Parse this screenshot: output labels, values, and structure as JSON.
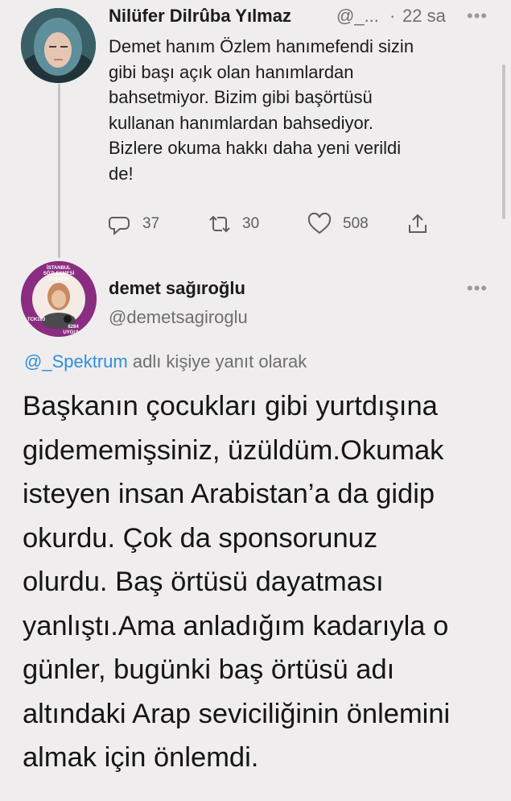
{
  "first_tweet": {
    "author_name": "Nilüfer Dilrûba Yılmaz",
    "handle": "@_...",
    "separator": "·",
    "time": "22 sa",
    "more": "•••",
    "text": [
      "Demet hanım Özlem hanımefendi sizin",
      "gibi başı açık olan hanımlardan",
      "bahsetmiyor. Bizim gibi başörtüsü",
      "kullanan hanımlardan bahsediyor.",
      "Bizlere okuma hakkı daha yeni verildi",
      "de!"
    ],
    "replies": "37",
    "retweets": "30",
    "likes": "508"
  },
  "second_tweet": {
    "author_name": "demet sağıroğlu",
    "handle": "@demetsagiroglu",
    "more": "•••",
    "avatar_ring_text_top": "İSTANBUL SÖZLEŞMESİ YAŞATIR",
    "avatar_ring_text_bottom": "6284 UYGULA",
    "avatar_ring_text_left": "TCK103",
    "reply_to_handle": "@_Spektrum",
    "reply_to_suffix": "adlı kişiye yanıt olarak",
    "text": [
      "Başkanın çocukları gibi yurtdışına",
      "gidememişsiniz, üzüldüm.Okumak",
      "isteyen insan Arabistan’a da gidip",
      "okurdu. Çok da sponsorunuz",
      "olurdu. Baş örtüsü dayatması",
      "yanlıştı.Ama anladığım kadarıyla o",
      "günler, bugünki baş örtüsü adı",
      "altındaki Arap seviciliğinin önlemini",
      "almak için önlemdi."
    ]
  },
  "colors": {
    "background": "#efedee",
    "link": "#2f8fd6",
    "avatar_ring": "#8a2c80"
  }
}
